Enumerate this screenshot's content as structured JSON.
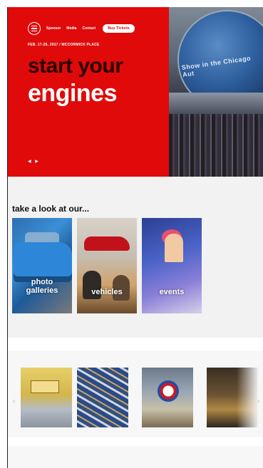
{
  "nav": {
    "links": [
      "Sponsor",
      "Media",
      "Contact"
    ],
    "tickets_label": "Buy Tickets"
  },
  "hero": {
    "event_date": "FEB. 17-26, 2017 / MCCORMICK PLACE",
    "headline_line1": "start your",
    "headline_line2": "engines",
    "list_heading": "",
    "list_left": [
      "",
      "",
      "",
      ""
    ],
    "list_right": [
      "",
      "",
      "",
      ""
    ],
    "footer_link": ""
  },
  "look_section": {
    "title": "take a look at our...",
    "cards": [
      {
        "line1": "photo",
        "line2": "galleries"
      },
      {
        "line1": "vehicles",
        "line2": ""
      },
      {
        "line1": "events",
        "line2": ""
      }
    ]
  },
  "colors": {
    "brand_red": "#e00a0a",
    "hero_dark_text": "#2a0000",
    "page_bg": "#f2f2f2"
  }
}
